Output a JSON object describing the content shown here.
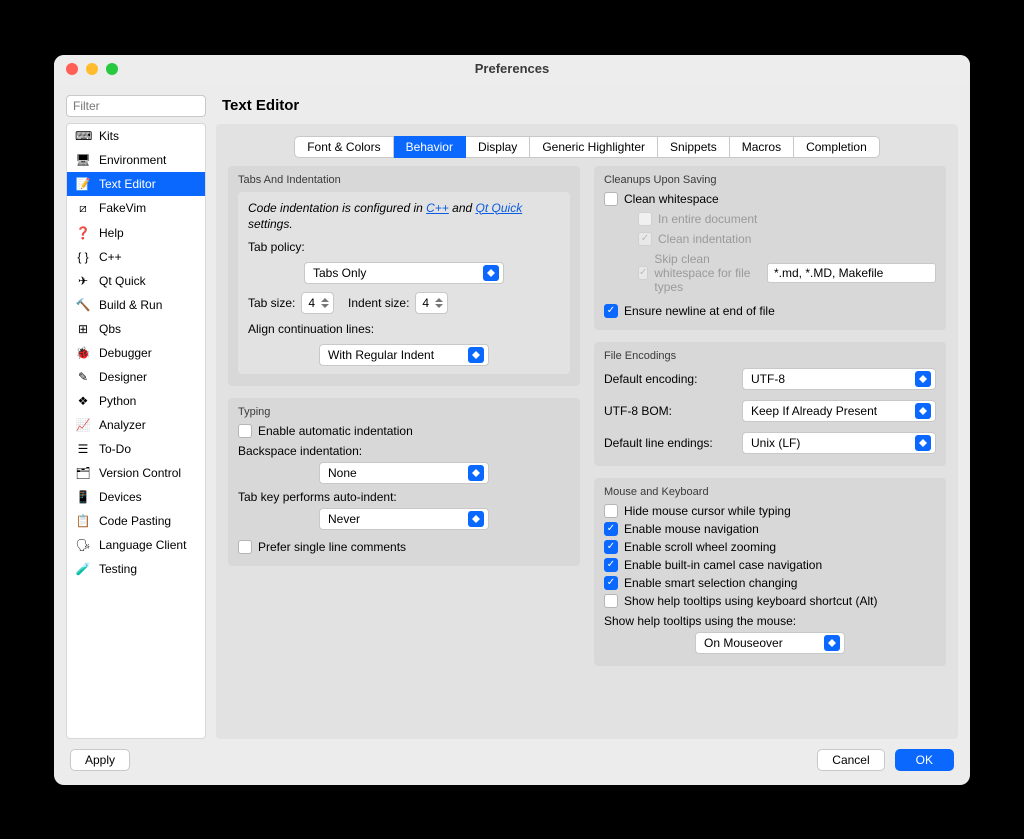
{
  "window": {
    "title": "Preferences"
  },
  "filter_placeholder": "Filter",
  "sidebar": {
    "items": [
      {
        "label": "Kits",
        "icon": "⌨"
      },
      {
        "label": "Environment",
        "icon": "🖥"
      },
      {
        "label": "Text Editor",
        "icon": "📝",
        "selected": true
      },
      {
        "label": "FakeVim",
        "icon": "⧄"
      },
      {
        "label": "Help",
        "icon": "❓"
      },
      {
        "label": "C++",
        "icon": "{ }"
      },
      {
        "label": "Qt Quick",
        "icon": "✈"
      },
      {
        "label": "Build & Run",
        "icon": "🔨"
      },
      {
        "label": "Qbs",
        "icon": "⊞"
      },
      {
        "label": "Debugger",
        "icon": "🐞"
      },
      {
        "label": "Designer",
        "icon": "✎"
      },
      {
        "label": "Python",
        "icon": "❖"
      },
      {
        "label": "Analyzer",
        "icon": "📈"
      },
      {
        "label": "To-Do",
        "icon": "☰"
      },
      {
        "label": "Version Control",
        "icon": "🗂"
      },
      {
        "label": "Devices",
        "icon": "📱"
      },
      {
        "label": "Code Pasting",
        "icon": "📋"
      },
      {
        "label": "Language Client",
        "icon": "🗣"
      },
      {
        "label": "Testing",
        "icon": "🧪"
      }
    ]
  },
  "page_title": "Text Editor",
  "tabs": [
    "Font & Colors",
    "Behavior",
    "Display",
    "Generic Highlighter",
    "Snippets",
    "Macros",
    "Completion"
  ],
  "active_tab": "Behavior",
  "left": {
    "tabs_section": "Tabs And Indentation",
    "note_pre": "Code indentation is configured in ",
    "note_link1": "C++",
    "note_mid": " and ",
    "note_link2": "Qt Quick",
    "note_post": " settings.",
    "tab_policy_label": "Tab policy:",
    "tab_policy_value": "Tabs Only",
    "tab_size_label": "Tab size:",
    "tab_size_value": "4",
    "indent_size_label": "Indent size:",
    "indent_size_value": "4",
    "align_label": "Align continuation lines:",
    "align_value": "With Regular Indent",
    "typing_section": "Typing",
    "enable_auto_indent": "Enable automatic indentation",
    "backspace_label": "Backspace indentation:",
    "backspace_value": "None",
    "tabkey_label": "Tab key performs auto-indent:",
    "tabkey_value": "Never",
    "prefer_single": "Prefer single line comments"
  },
  "right": {
    "cleanups_section": "Cleanups Upon Saving",
    "clean_ws": "Clean whitespace",
    "in_entire": "In entire document",
    "clean_indent": "Clean indentation",
    "skip_label": "Skip clean whitespace for file types",
    "skip_value": "*.md, *.MD, Makefile",
    "ensure_newline": "Ensure newline at end of file",
    "encodings_section": "File Encodings",
    "default_encoding_label": "Default encoding:",
    "default_encoding_value": "UTF-8",
    "bom_label": "UTF-8 BOM:",
    "bom_value": "Keep If Already Present",
    "endings_label": "Default line endings:",
    "endings_value": "Unix (LF)",
    "mouse_section": "Mouse and Keyboard",
    "hide_cursor": "Hide mouse cursor while typing",
    "mouse_nav": "Enable mouse navigation",
    "scroll_zoom": "Enable scroll wheel zooming",
    "camelcase": "Enable built-in camel case navigation",
    "smart_sel": "Enable smart selection changing",
    "help_alt": "Show help tooltips using keyboard shortcut (Alt)",
    "help_mouse_label": "Show help tooltips using the mouse:",
    "help_mouse_value": "On Mouseover"
  },
  "buttons": {
    "apply": "Apply",
    "cancel": "Cancel",
    "ok": "OK"
  }
}
